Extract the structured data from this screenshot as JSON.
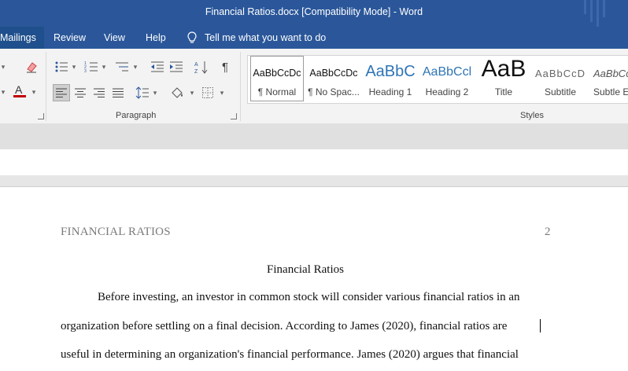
{
  "window": {
    "title": "Financial Ratios.docx [Compatibility Mode]  -  Word"
  },
  "menu": {
    "tabs": [
      "Mailings",
      "Review",
      "View",
      "Help"
    ],
    "active_tab": "Mailings",
    "tell_me": "Tell me what you want to do"
  },
  "ribbon": {
    "paragraph_label": "Paragraph",
    "styles_label": "Styles",
    "styles": [
      {
        "sample": "AaBbCcDc",
        "name": "¶ Normal"
      },
      {
        "sample": "AaBbCcDc",
        "name": "¶ No Spac..."
      },
      {
        "sample": "AaBbC",
        "name": "Heading 1"
      },
      {
        "sample": "AaBbCcl",
        "name": "Heading 2"
      },
      {
        "sample": "AaB",
        "name": "Title"
      },
      {
        "sample": "AaBbCcD",
        "name": "Subtitle"
      },
      {
        "sample": "AaBbCc",
        "name": "Subtle Em"
      }
    ],
    "colors": {
      "accent": "#2b579a",
      "font_color_bar": "#c00000",
      "heading_blue": "#2e74b5"
    }
  },
  "document": {
    "running_head": "FINANCIAL RATIOS",
    "page_number": "2",
    "title": "Financial Ratios",
    "lines": [
      "Before investing, an investor in common stock will consider various financial ratios in an",
      "organization before settling on a final decision. According to James (2020), financial ratios are",
      "useful in determining an organization's financial performance. James (2020) argues that financial"
    ]
  }
}
